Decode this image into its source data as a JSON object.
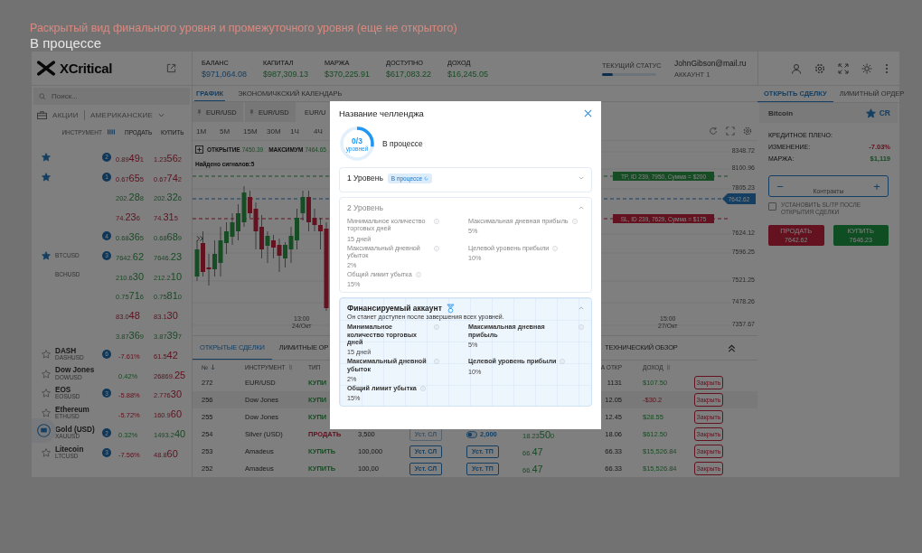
{
  "annotation": {
    "caption": "Раскрытый вид финального уровня и промежуточного уровня (еще не открытого)",
    "status": "В процессе"
  },
  "header": {
    "logo": "XCritical",
    "stats": [
      {
        "label": "БАЛАНС",
        "value": "$971,064.08",
        "primary": true
      },
      {
        "label": "КАПИТАЛ",
        "value": "$987,309.13",
        "primary": false
      },
      {
        "label": "МАРЖА",
        "value": "$370,225.91",
        "primary": false
      },
      {
        "label": "ДОСТУПНО",
        "value": "$617,083.22",
        "primary": false
      },
      {
        "label": "ДОХОД",
        "value": "$16,245.05",
        "primary": false
      }
    ],
    "status": {
      "label": "ТЕКУЩИЙ СТАТУС",
      "level": 0.2
    },
    "account": {
      "email": "JohnGibson@mail.ru",
      "name": "АККАУНТ 1"
    }
  },
  "watchlist": {
    "search_placeholder": "Поиск...",
    "market": "АКЦИИ",
    "region": "АМЕРИКАНСКИЕ",
    "columns": [
      "ИНСТРУМЕНТ",
      "ПРОДАТЬ",
      "КУПИТЬ"
    ],
    "rows": [
      {
        "starred": true,
        "badge": "2",
        "sell": {
          "kind": "price",
          "pre": "0.89",
          "big": "49",
          "post": "1",
          "rising": false
        },
        "buy": {
          "kind": "price",
          "pre": "1.23",
          "big": "56",
          "post": "2",
          "rising": false
        }
      },
      {
        "starred": true,
        "badge": "1",
        "sell": {
          "kind": "price",
          "pre": "0.67",
          "big": "65",
          "post": "5",
          "rising": false
        },
        "buy": {
          "kind": "price",
          "pre": "0.67",
          "big": "74",
          "post": "2",
          "rising": false
        }
      },
      {
        "sell": {
          "kind": "price",
          "pre": "202.",
          "big": "28",
          "post": "8",
          "rising": true
        },
        "buy": {
          "kind": "price",
          "pre": "202.",
          "big": "32",
          "post": "6",
          "rising": true
        }
      },
      {
        "sell": {
          "kind": "price",
          "pre": "74.",
          "big": "23",
          "post": "6",
          "rising": false
        },
        "buy": {
          "kind": "price",
          "pre": "74.",
          "big": "31",
          "post": "5",
          "rising": false
        }
      },
      {
        "badge": "4",
        "sell": {
          "kind": "price",
          "pre": "0.68",
          "big": "36",
          "post": "5",
          "rising": true
        },
        "buy": {
          "kind": "price",
          "pre": "0.68",
          "big": "68",
          "post": "9",
          "rising": true
        }
      },
      {
        "starred": true,
        "symbol": "BTCUSD",
        "badge": "3",
        "sell": {
          "kind": "price",
          "pre": "7642.",
          "big": "62",
          "rising": true
        },
        "buy": {
          "kind": "price",
          "pre": "7646.",
          "big": "23",
          "rising": true
        }
      },
      {
        "symbol": "BCHUSD",
        "sell": {
          "kind": "price",
          "pre": "210.6",
          "big": "30",
          "rising": true
        },
        "buy": {
          "kind": "price",
          "pre": "212.2",
          "big": "10",
          "rising": true
        }
      },
      {
        "sell": {
          "kind": "price",
          "pre": "0.75",
          "big": "71",
          "post": "6",
          "rising": true
        },
        "buy": {
          "kind": "price",
          "pre": "0.75",
          "big": "81",
          "post": "0",
          "rising": true
        }
      },
      {
        "sell": {
          "kind": "price",
          "pre": "83.0",
          "big": "48",
          "rising": false
        },
        "buy": {
          "kind": "price",
          "pre": "83.1",
          "big": "30",
          "rising": false
        }
      },
      {
        "sell": {
          "kind": "price",
          "pre": "3.87",
          "big": "36",
          "post": "9",
          "rising": true
        },
        "buy": {
          "kind": "price",
          "pre": "3.87",
          "big": "39",
          "post": "7",
          "rising": true
        }
      },
      {
        "starred": false,
        "name": "DASH",
        "symbol": "DASHUSD",
        "badge": "6",
        "sell": {
          "kind": "change",
          "text": "-7.61%",
          "rising": false
        },
        "buy": {
          "kind": "price",
          "pre": "61.5",
          "big": "42",
          "rising": false
        }
      },
      {
        "starred": false,
        "name": "Dow Jones",
        "symbol": "DOWUSD",
        "sell": {
          "kind": "change",
          "text": "0.42%",
          "rising": true
        },
        "buy": {
          "kind": "price",
          "pre": "26869.",
          "big": "25",
          "rising": false
        }
      },
      {
        "starred": false,
        "name": "EOS",
        "symbol": "EOSUSD",
        "badge": "3",
        "sell": {
          "kind": "change",
          "text": "-5.88%",
          "rising": false
        },
        "buy": {
          "kind": "price",
          "pre": "2.776",
          "big": "30",
          "rising": false
        }
      },
      {
        "starred": false,
        "name": "Ethereum",
        "symbol": "ETHUSD",
        "sell": {
          "kind": "change",
          "text": "-5.72%",
          "rising": false
        },
        "buy": {
          "kind": "price",
          "pre": "160.9",
          "big": "60",
          "rising": false
        }
      },
      {
        "name": "Gold (USD)",
        "symbol": "XAUUSD",
        "badge": "2",
        "sell": {
          "kind": "change",
          "text": "0.32%",
          "rising": true
        },
        "buy": {
          "kind": "price",
          "pre": "1493.2",
          "big": "40",
          "rising": true
        }
      },
      {
        "starred": false,
        "name": "Litecoin",
        "symbol": "LTCUSD",
        "badge": "3",
        "sell": {
          "kind": "change",
          "text": "-7.56%",
          "rising": false
        },
        "buy": {
          "kind": "price",
          "pre": "48.8",
          "big": "60",
          "rising": false
        }
      }
    ]
  },
  "chart": {
    "tabs": [
      {
        "label": "ГРАФИК",
        "selected": true
      },
      {
        "label": "ЭКОНОМИЧКСКИЙ КАЛЕНДАРЬ",
        "selected": false
      }
    ],
    "symbols": [
      {
        "label": "EUR/USD",
        "pinned": true
      },
      {
        "label": "EUR/USD",
        "pinned": true
      },
      {
        "label": "EUR/U",
        "pinned": false
      }
    ],
    "timeframes": [
      "1М",
      "5М",
      "15М",
      "30М",
      "1Ч",
      "4Ч"
    ],
    "open": {
      "label": "ОТКРЫТИЕ",
      "value": "7450.39"
    },
    "high": {
      "label": "МАКСИМУМ",
      "value": "7464.65"
    },
    "signals": "Найдено сигналов:5",
    "price_axis": [
      "8348.72",
      "8100.96",
      "7805.23",
      "7624.12",
      "7596.25",
      "7521.25",
      "7478.26",
      "7357.67"
    ],
    "tp_line": "TP, ID 239, 7950, Сумма = $200",
    "sl_line": "SL, ID 239, 7629, Сумма = $175",
    "price_tag": "7642.62",
    "time_axis": [
      {
        "time": "13:00",
        "date": "24/Окт"
      },
      {
        "time": "15:00",
        "date": "27/Окт"
      }
    ]
  },
  "trades": {
    "tabs": [
      {
        "label": "ОТКРЫТЫЕ СДЕЛКИ",
        "selected": true
      },
      {
        "label": "ЛИМИТНЫЕ ОР",
        "selected": false
      },
      {
        "label": "ТЕХНИЧЕСКИЙ ОБЗОР",
        "selected": false
      }
    ],
    "headers": {
      "number": "№",
      "instrument": "ИНСТРУМЕНТ",
      "type": "ТИП",
      "open_price": "А ОТКР",
      "profit": "ДОХОД"
    },
    "rows": [
      {
        "number": "272",
        "instrument": "EUR/USD",
        "side": {
          "text": "КУПИ",
          "kind": "buy"
        },
        "open_price": "1131",
        "profit": {
          "text": "$107.50",
          "negative": false
        },
        "close": "Закрыть"
      },
      {
        "number": "256",
        "instrument": "Dow Jones",
        "side": {
          "text": "КУПИ",
          "kind": "buy"
        },
        "open_price": "12.05",
        "profit": {
          "text": "-$30.2",
          "negative": true
        },
        "close": "Закрыть"
      },
      {
        "number": "255",
        "instrument": "Dow Jones",
        "side": {
          "text": "КУПИ",
          "kind": "buy"
        },
        "open_price": "12.45",
        "profit": {
          "text": "$28.55",
          "negative": false
        },
        "close": "Закрыть"
      },
      {
        "number": "254",
        "instrument": "Silver (USD)",
        "side": {
          "text": "ПРОДАТЬ",
          "kind": "sell"
        },
        "amount": "3,500",
        "sl": {
          "label": "Уст. СЛ",
          "disabled": true
        },
        "tp": {
          "kind": "value",
          "text": "2,000"
        },
        "current": {
          "pre": "18.23",
          "big": "50",
          "post": "0"
        },
        "open_price": "18.06",
        "profit": {
          "text": "$612.50",
          "negative": false
        },
        "close": "Закрыть"
      },
      {
        "number": "253",
        "instrument": "Amadeus",
        "side": {
          "text": "КУПИТЬ",
          "kind": "buy"
        },
        "amount": "100,000",
        "sl": {
          "label": "Уст. СЛ",
          "disabled": false
        },
        "tp": {
          "kind": "button",
          "text": "Уст. ТП"
        },
        "current": {
          "pre": "66.",
          "big": "47"
        },
        "open_price": "66.33",
        "profit": {
          "text": "$15,526.84",
          "negative": false
        },
        "close": "Закрыть"
      },
      {
        "number": "252",
        "instrument": "Amadeus",
        "side": {
          "text": "КУПИТЬ",
          "kind": "buy"
        },
        "amount": "100,00",
        "sl": {
          "label": "Уст. СЛ",
          "disabled": false
        },
        "tp": {
          "kind": "button",
          "text": "Уст. ТП"
        },
        "current": {
          "pre": "66.",
          "big": "47"
        },
        "open_price": "66.33",
        "profit": {
          "text": "$15,526.84",
          "negative": false
        },
        "close": "Закрыть"
      }
    ]
  },
  "order": {
    "tabs": [
      {
        "label": "ОТКРЫТЬ СДЕЛКУ",
        "selected": true
      },
      {
        "label": "ЛИМИТНЫЙ ОРДЕР",
        "selected": false
      }
    ],
    "instrument": "Bitcoin",
    "starred": true,
    "code": "CR",
    "fields": [
      {
        "label": "КРЕДИТНОЕ ПЛЕЧО:"
      },
      {
        "label": "ИЗМЕНЕНИЕ:",
        "value": "-7.03%",
        "negative": true
      },
      {
        "label": "МАРЖА:",
        "value": "$1,119",
        "negative": false
      }
    ],
    "minus": "−",
    "plus": "+",
    "contracts_placeholder": "Контракты",
    "sltp": {
      "label": "УСТАНОВИТЬ SL/TP ПОСЛЕ ОТКРЫТИЯ СДЕЛКИ",
      "checked": false
    },
    "sell": {
      "label": "ПРОДАТЬ",
      "price": "7642.62"
    },
    "buy": {
      "label": "КУПИТЬ",
      "price": "7646.23"
    }
  },
  "challenge": {
    "title": "Название челленджа",
    "progress": {
      "count": "0/3",
      "unit": "уровней",
      "level": 0.28
    },
    "status": "В процессе",
    "sections": [
      {
        "kind": "level",
        "title": "1 Уровень",
        "badge": "В процессе",
        "expanded": false,
        "disabled": false
      },
      {
        "kind": "level",
        "title": "2 Уровень",
        "expanded": true,
        "disabled": true,
        "rules": [
          {
            "label": "Минимальное количество торговых дней",
            "value": "15 дней"
          },
          {
            "label": "Максимальная дневная прибыль",
            "value": "5%"
          },
          {
            "label": "Максимальный дневной убыток",
            "value": "2%"
          },
          {
            "label": "Целевой уровень прибыли",
            "value": "10%"
          },
          {
            "label": "Общий лимит убытка",
            "value": "15%"
          }
        ]
      },
      {
        "kind": "funded",
        "title": "Финансируемый аккаунт",
        "expanded": true,
        "disabled": false,
        "note": "Он станет доступен после завершения всех уровней.",
        "rules": [
          {
            "label": "Минимальное количество торговых дней",
            "value": "15 дней"
          },
          {
            "label": "Максимальная дневная прибыль",
            "value": "5%"
          },
          {
            "label": "Максимальный дневной убыток",
            "value": "2%"
          },
          {
            "label": "Целевой уровень прибыли",
            "value": "10%"
          },
          {
            "label": "Общий лимит убытка",
            "value": "15%"
          }
        ]
      }
    ]
  }
}
